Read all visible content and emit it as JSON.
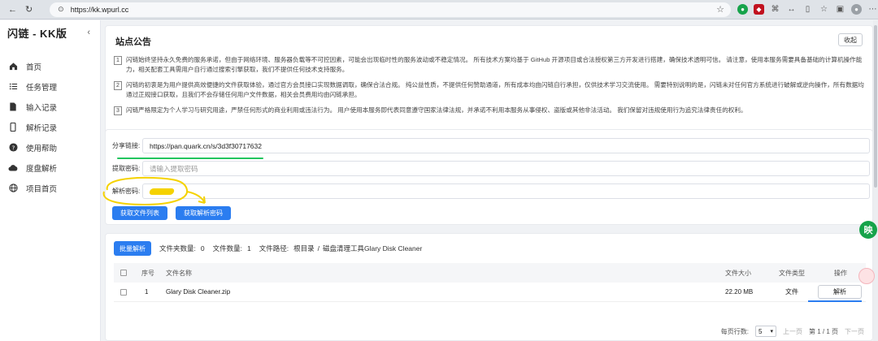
{
  "browser": {
    "url": "https://kk.wpurl.cc"
  },
  "sidebar": {
    "logo": "闪链 - KK版",
    "items": [
      {
        "label": "首页",
        "icon": "home-icon"
      },
      {
        "label": "任务管理",
        "icon": "list-icon"
      },
      {
        "label": "输入记录",
        "icon": "document-icon"
      },
      {
        "label": "解析记录",
        "icon": "phone-icon"
      },
      {
        "label": "使用帮助",
        "icon": "help-icon"
      },
      {
        "label": "度盘解析",
        "icon": "cloud-icon"
      },
      {
        "label": "项目首页",
        "icon": "globe-icon"
      }
    ]
  },
  "notice": {
    "title": "站点公告",
    "collapse_label": "收起",
    "items": [
      {
        "num": "1",
        "text": "闪链始终坚持永久免费的服务承诺，但由于网络环境、服务器负载等不可控因素，可能会出现临时性的服务波动或不稳定情况。 所有技术方案均基于 GitHub 开源项目或合法授权第三方开发进行搭建，确保技术透明可信。 请注意，使用本服务需要具备基础的计算机操作能力，相关配套工具需用户自行通过搜索引擎获取，我们不提供任何技术支持服务。"
      },
      {
        "num": "2",
        "text": "闪链的初衷是为用户提供高效便捷的文件获取体验，通过官方会员接口实现数据调取，确保合法合规。 纯公益性质，不提供任何赞助通道，所有成本均由闪链自行承担，仅供技术学习交流使用。 需要特别说明的是，闪链未对任何官方系统进行破解或逆向操作，所有数据均通过正规接口获取，且我们不会存储任何用户文件数据，相关会员费用均由闪链承担。"
      },
      {
        "num": "3",
        "text": "闪链严格限定为个人学习与研究用途，严禁任何形式的商业利用或违法行为。 用户使用本服务即代表同意遵守国家法律法规，并承诺不利用本服务从事侵权、盗版或其他非法活动。 我们保留对违规使用行为追究法律责任的权利。"
      }
    ]
  },
  "form": {
    "share_label": "分享链接:",
    "share_value": "https://pan.quark.cn/s/3d3f30717632",
    "extract_label": "提取密码:",
    "extract_placeholder": "请输入提取密码",
    "parse_label": "解析密码:",
    "btn_get_list": "获取文件列表",
    "btn_get_pwd": "获取解析密码"
  },
  "files": {
    "batch_label": "批量解析",
    "folder_count_label": "文件夹数量:",
    "folder_count": "0",
    "file_count_label": "文件数量:",
    "file_count": "1",
    "path_label": "文件路径:",
    "path_root": "根目录",
    "path_sep": "/",
    "path_folder": "磁盘清理工具Glary Disk Cleaner",
    "columns": {
      "no": "序号",
      "name": "文件名称",
      "size": "文件大小",
      "type": "文件类型",
      "op": "操作"
    },
    "rows": [
      {
        "no": "1",
        "name": "Glary Disk Cleaner.zip",
        "size": "22.20 MB",
        "type": "文件",
        "op": "解析"
      }
    ],
    "pager": {
      "per_page_label": "每页行数:",
      "per_page": "5",
      "prev": "上一页",
      "page_info": "第 1 / 1 页",
      "next": "下一页"
    }
  },
  "float": {
    "green_label": "映"
  },
  "colors": {
    "accent": "#2b7df0",
    "highlight": "#f5d200",
    "green_underline": "#22c55e"
  }
}
